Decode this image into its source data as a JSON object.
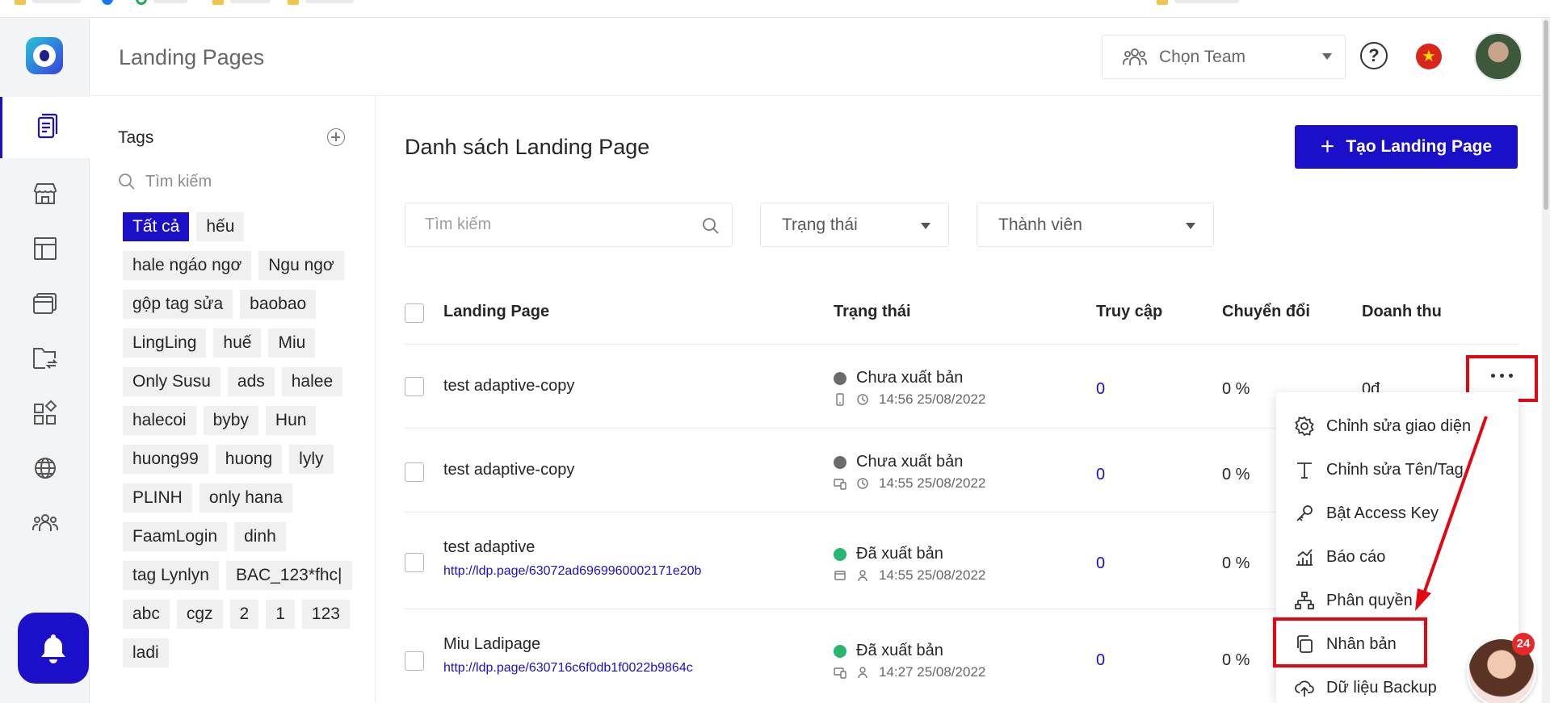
{
  "header": {
    "page_title": "Landing Pages",
    "team_select": "Chọn Team",
    "help_symbol": "?",
    "flag_symbol": "★"
  },
  "rail": {
    "icons": [
      "pages-icon",
      "store-icon",
      "template-icon",
      "browser-icon",
      "folder-transfer-icon",
      "apps-icon",
      "globe-icon",
      "team-icon"
    ],
    "active": "pages-icon",
    "bell_icon": "bell-icon"
  },
  "tags_panel": {
    "title": "Tags",
    "search_placeholder": "Tìm kiếm",
    "chips": [
      "Tất cả",
      "hếu",
      "hale ngáo ngơ",
      "Ngu ngơ",
      "gộp tag sửa",
      "baobao",
      "LingLing",
      "huế",
      "Miu",
      "Only Susu",
      "ads",
      "halee",
      "halecoi",
      "byby",
      "Hun",
      "huong99",
      "huong",
      "lyly",
      "PLINH",
      "only hana",
      "FaamLogin",
      "dinh",
      "tag Lynlyn",
      "BAC_123*fhc|",
      "abc",
      "cgz",
      "2",
      "1",
      "123",
      "ladi"
    ],
    "active_chip": "Tất cả"
  },
  "main": {
    "title": "Danh sách Landing Page",
    "create_button": "Tạo Landing Page",
    "create_plus": "+",
    "search_placeholder": "Tìm kiếm",
    "filter_status": "Trạng thái",
    "filter_member": "Thành viên",
    "columns": {
      "name": "Landing Page",
      "status": "Trạng thái",
      "visits": "Truy cập",
      "conversion": "Chuyển đổi",
      "revenue": "Doanh thu"
    },
    "rows": [
      {
        "name": "test adaptive-copy",
        "link": "",
        "status": "Chưa xuất bản",
        "status_color": "#6b6b6b",
        "time": "14:56 25/08/2022",
        "visits": "0",
        "conversion": "0 %",
        "revenue": "0đ"
      },
      {
        "name": "test adaptive-copy",
        "link": "",
        "status": "Chưa xuất bản",
        "status_color": "#6b6b6b",
        "time": "14:55 25/08/2022",
        "visits": "0",
        "conversion": "0 %",
        "revenue": ""
      },
      {
        "name": "test adaptive",
        "link": "http://ldp.page/63072ad6969960002171e20b",
        "status": "Đã xuất bản",
        "status_color": "#27b76f",
        "time": "14:55 25/08/2022",
        "visits": "0",
        "conversion": "0 %",
        "revenue": ""
      },
      {
        "name": "Miu Ladipage",
        "link": "http://ldp.page/630716c6f0db1f0022b9864c",
        "status": "Đã xuất bản",
        "status_color": "#27b76f",
        "time": "14:27 25/08/2022",
        "visits": "0",
        "conversion": "0 %",
        "revenue": ""
      }
    ]
  },
  "context_menu": {
    "items": [
      {
        "label": "Chỉnh sửa giao diện",
        "icon": "gear-icon"
      },
      {
        "label": "Chỉnh sửa Tên/Tag",
        "icon": "text-icon"
      },
      {
        "label": "Bật Access Key",
        "icon": "key-icon"
      },
      {
        "label": "Báo cáo",
        "icon": "chart-icon"
      },
      {
        "label": "Phân quyền",
        "icon": "hierarchy-icon"
      },
      {
        "label": "Nhân bản",
        "icon": "copy-icon"
      },
      {
        "label": "Dữ liệu Backup",
        "icon": "cloud-upload-icon"
      }
    ]
  },
  "chat": {
    "badge": "24"
  },
  "colors": {
    "accent": "#1b0fc9",
    "highlight": "#e30613",
    "published": "#27b76f",
    "unpublished": "#6b6b6b"
  }
}
